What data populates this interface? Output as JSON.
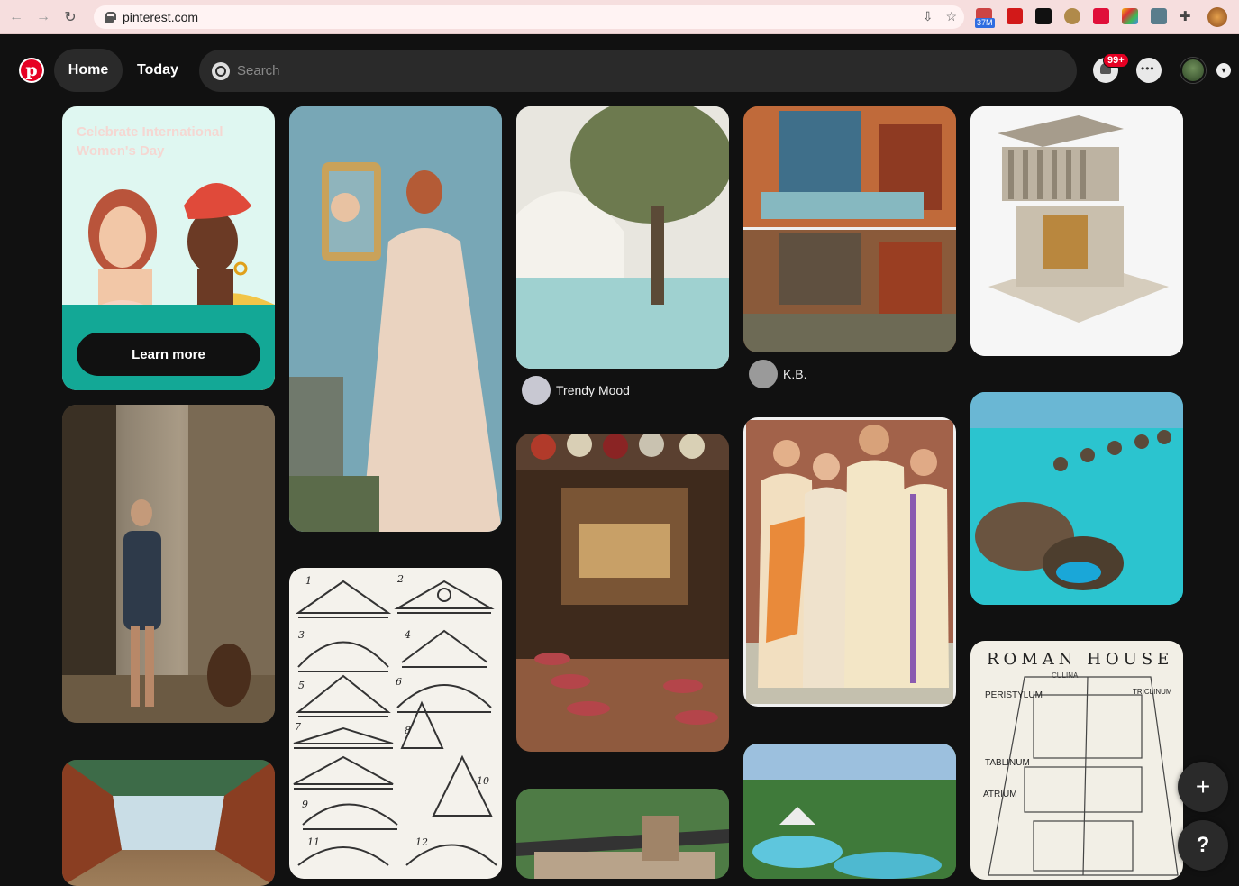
{
  "browser": {
    "url": "pinterest.com",
    "extension_badge": "37M"
  },
  "header": {
    "home_label": "Home",
    "today_label": "Today",
    "search_placeholder": "Search",
    "notification_count": "99+"
  },
  "promo": {
    "title": "Celebrate International Women's Day",
    "button_label": "Learn more"
  },
  "creators": [
    {
      "name": "Trendy Mood"
    },
    {
      "name": "K.B."
    }
  ],
  "roman_house": {
    "title": "ROMAN HOUSE",
    "labels": [
      "PERISTYLUM",
      "TABLINUM",
      "ATRIUM",
      "TRICLINUM",
      "CULINA"
    ]
  },
  "pediment_numbers": [
    "1",
    "2",
    "3",
    "4",
    "5",
    "6",
    "7",
    "8",
    "9",
    "10",
    "11",
    "12"
  ],
  "fab": {
    "add_icon": "plus-icon",
    "help_label": "?"
  },
  "colors": {
    "brand": "#e60023",
    "bg": "#111111",
    "pill": "#2a2a2a"
  }
}
